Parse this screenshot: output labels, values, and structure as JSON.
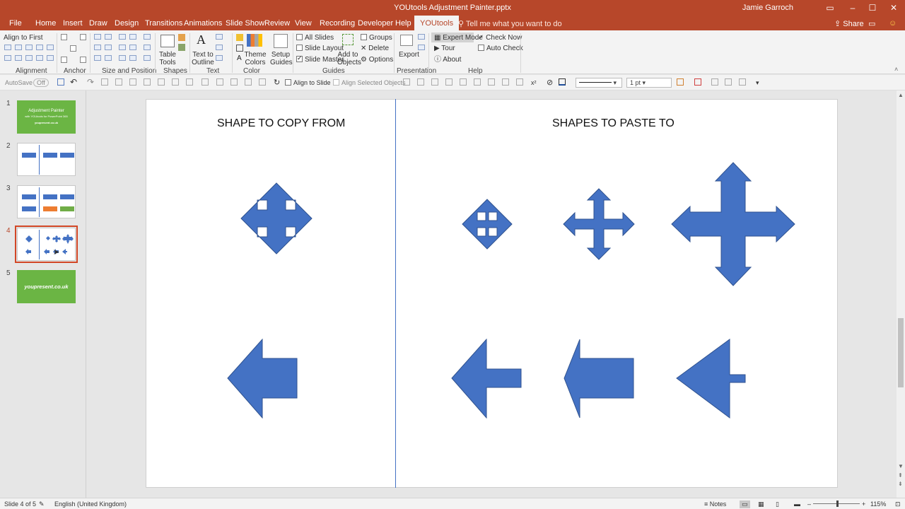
{
  "window": {
    "title": "YOUtools Adjustment Painter.pptx",
    "user": "Jamie Garroch"
  },
  "tabs": [
    "File",
    "Home",
    "Insert",
    "Draw",
    "Design",
    "Transitions",
    "Animations",
    "Slide Show",
    "Review",
    "View",
    "Recording",
    "Developer",
    "Help",
    "YOUtools"
  ],
  "active_tab": "YOUtools",
  "tell_me": "Tell me what you want to do",
  "share": "Share",
  "ribbon": {
    "align_first": "Align to First",
    "groups": {
      "alignment": "Alignment",
      "anchor": "Anchor",
      "size_position": "Size and Position",
      "shapes": "Shapes",
      "text": "Text",
      "color": "Color",
      "guides": "Guides",
      "presentation": "Presentation",
      "help": "Help"
    },
    "table_tools": [
      "Table",
      "Tools"
    ],
    "text_to_outline": [
      "Text to",
      "Outline"
    ],
    "theme_colors": [
      "Theme",
      "Colors"
    ],
    "setup_guides": [
      "Setup",
      "Guides"
    ],
    "all_slides": "All Slides",
    "slide_layout": "Slide Layout",
    "slide_master": "Slide Master",
    "add_to_objects": [
      "Add to",
      "Objects"
    ],
    "groups_label": "Groups",
    "delete": "Delete",
    "options": "Options",
    "export": "Export",
    "expert_mode": "Expert Mode",
    "tour": "Tour",
    "about": "About",
    "check_now": "Check Now",
    "auto_check": "Auto Check"
  },
  "qat": {
    "autosave": "AutoSave",
    "autosave_state": "Off",
    "align_to_slide": "Align to Slide",
    "align_selected": "Align Selected Objects",
    "line_weight": "1 pt"
  },
  "slides": [
    {
      "num": "1",
      "title": "Adjustment Painter",
      "subtitle": "with YOUtools for PowerPoint 365",
      "footer": "youpresent.co.uk"
    },
    {
      "num": "2"
    },
    {
      "num": "3"
    },
    {
      "num": "4"
    },
    {
      "num": "5",
      "text": "youpresent.co.uk"
    }
  ],
  "slide": {
    "left_heading": "SHAPE TO COPY FROM",
    "right_heading": "SHAPES TO PASTE TO",
    "shape_color": "#4472c4"
  },
  "status": {
    "slide_info": "Slide 4 of 5",
    "language": "English (United Kingdom)",
    "notes": "Notes",
    "zoom": "115%"
  }
}
